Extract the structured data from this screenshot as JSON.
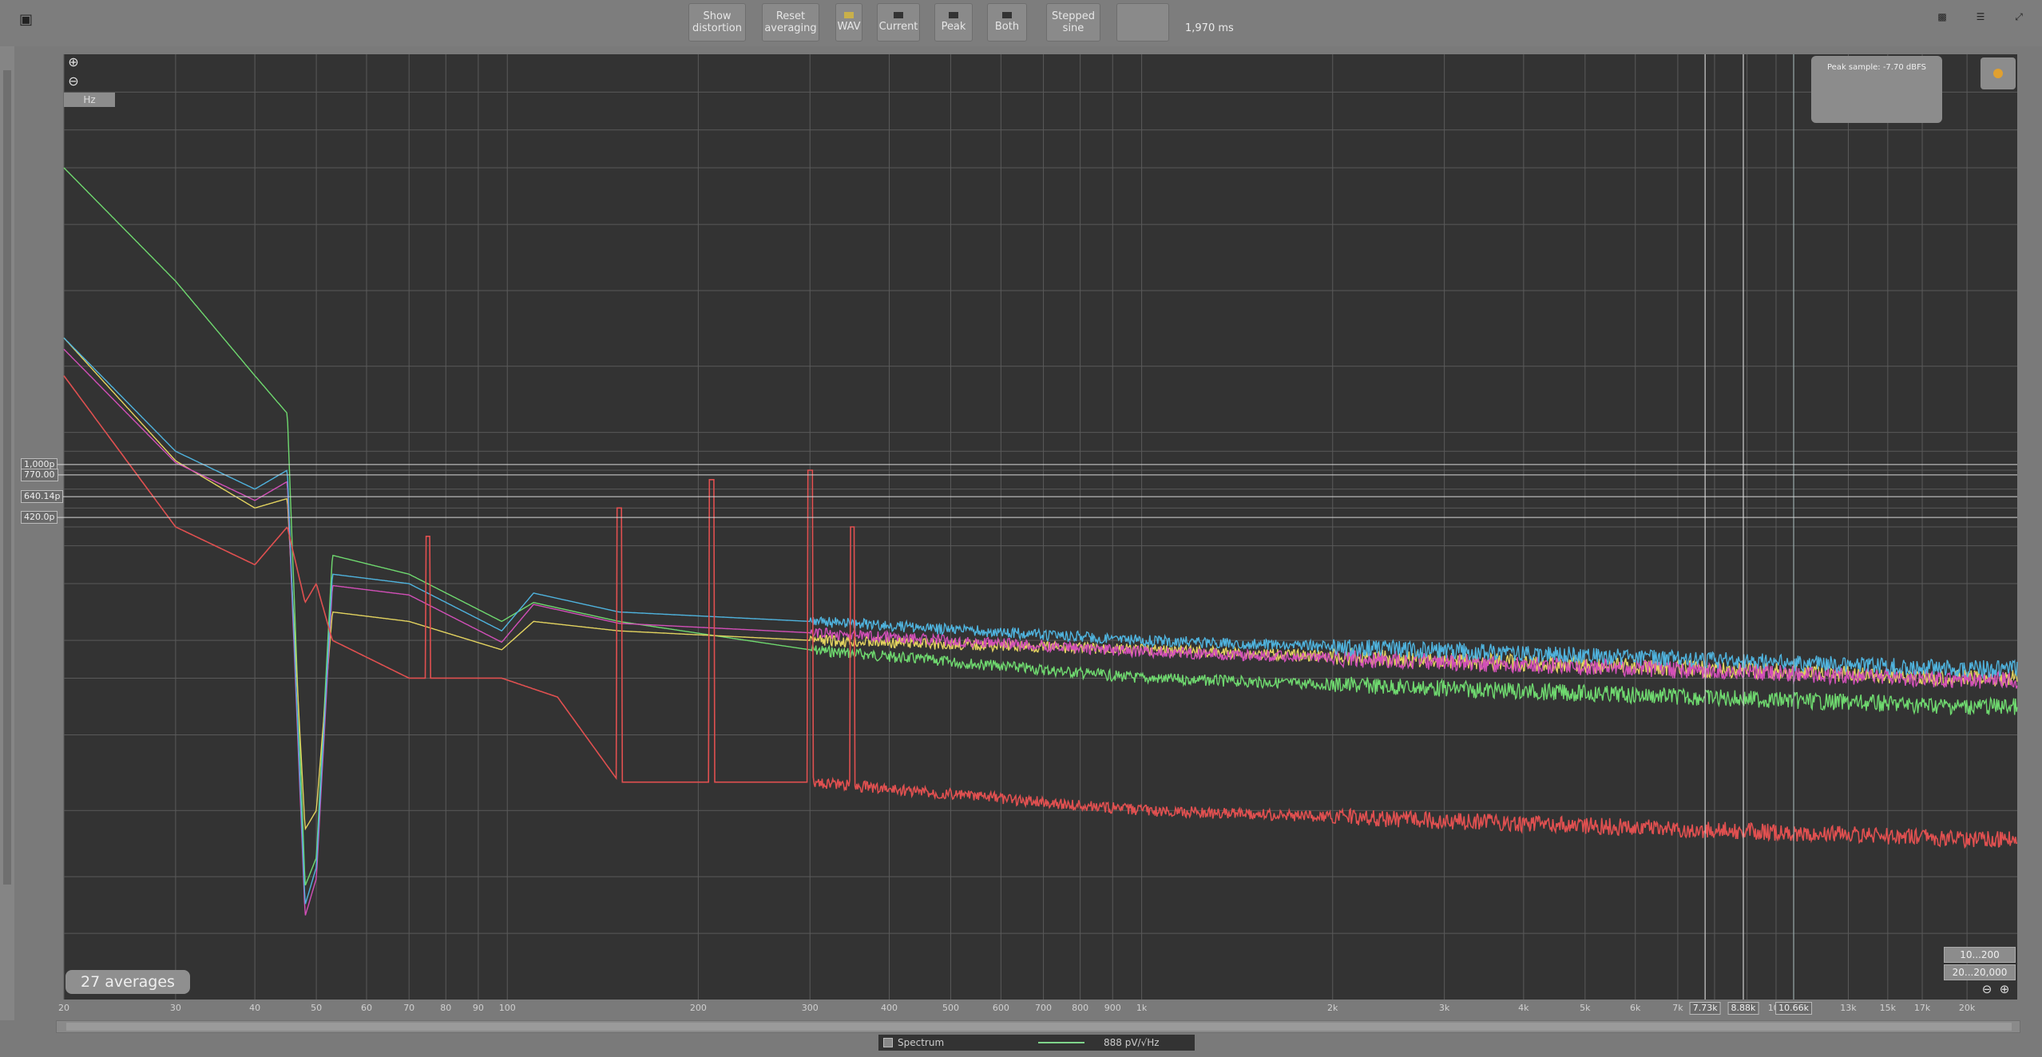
{
  "toolbar": {
    "buttons": [
      {
        "id": "show-distortion",
        "label": "Show\ndistortion"
      },
      {
        "id": "reset-averaging",
        "label": "Reset\naveraging"
      },
      {
        "id": "wav",
        "label": "WAV"
      },
      {
        "id": "current",
        "label": "Current"
      },
      {
        "id": "peak",
        "label": "Peak"
      },
      {
        "id": "both",
        "label": "Both"
      },
      {
        "id": "stepped-sine",
        "label": "Stepped\nsine"
      }
    ],
    "readout": "1,970 ms"
  },
  "plot": {
    "hz_label": "Hz",
    "averages_label": "27 averages",
    "range_top": "10...200",
    "range_bottom": "20...20,000",
    "info_box_lines": [
      "Peak sample: -7.70 dBFS"
    ]
  },
  "cursors": {
    "x_labels": [
      "7.73k",
      "8.88k",
      "10.66k"
    ],
    "y_labels": [
      "1,000p",
      "770.00",
      "640.14p",
      "420.0p"
    ]
  },
  "legend": {
    "name": "Spectrum",
    "value": "888 pV/√Hz",
    "color": "#7fd48a"
  },
  "chart_data": {
    "type": "line",
    "x_scale": "log",
    "xlim": [
      20,
      24000
    ],
    "xticks": [
      "20",
      "30",
      "40",
      "50",
      "60",
      "70",
      "80",
      "90",
      "100",
      "200",
      "300",
      "400",
      "500",
      "600",
      "700",
      "800",
      "900",
      "1k",
      "2k",
      "3k",
      "4k",
      "5k",
      "6k",
      "7k",
      "8k",
      "9k",
      "10k",
      "13k",
      "15k",
      "17k",
      "20k"
    ],
    "colors": {
      "blue": "#4fb3de",
      "magenta": "#d24fb8",
      "yellow": "#e3d35f",
      "green": "#6fd96f",
      "red": "#e05050"
    },
    "series": [
      {
        "id": "blue",
        "points": [
          [
            20,
            0.3
          ],
          [
            30,
            0.42
          ],
          [
            40,
            0.46
          ],
          [
            45,
            0.44
          ],
          [
            48,
            0.9
          ],
          [
            50,
            0.86
          ],
          [
            53,
            0.55
          ],
          [
            70,
            0.56
          ],
          [
            98,
            0.61
          ],
          [
            110,
            0.57
          ],
          [
            150,
            0.59
          ],
          [
            300,
            0.6
          ],
          [
            1000,
            0.62
          ],
          [
            20000,
            0.65
          ]
        ]
      },
      {
        "id": "yellow",
        "points": [
          [
            20,
            0.3
          ],
          [
            30,
            0.43
          ],
          [
            40,
            0.48
          ],
          [
            45,
            0.47
          ],
          [
            48,
            0.82
          ],
          [
            50,
            0.8
          ],
          [
            53,
            0.59
          ],
          [
            70,
            0.6
          ],
          [
            98,
            0.63
          ],
          [
            110,
            0.6
          ],
          [
            150,
            0.61
          ],
          [
            300,
            0.62
          ],
          [
            1000,
            0.63
          ],
          [
            20000,
            0.66
          ]
        ]
      },
      {
        "id": "green",
        "points": [
          [
            20,
            0.12
          ],
          [
            30,
            0.24
          ],
          [
            40,
            0.34
          ],
          [
            45,
            0.38
          ],
          [
            48,
            0.88
          ],
          [
            50,
            0.85
          ],
          [
            53,
            0.53
          ],
          [
            70,
            0.55
          ],
          [
            98,
            0.6
          ],
          [
            110,
            0.58
          ],
          [
            150,
            0.6
          ],
          [
            300,
            0.63
          ],
          [
            1000,
            0.66
          ],
          [
            20000,
            0.69
          ]
        ]
      },
      {
        "id": "red",
        "points": [
          [
            20,
            0.34
          ],
          [
            30,
            0.5
          ],
          [
            40,
            0.54
          ],
          [
            45,
            0.5
          ],
          [
            48,
            0.58
          ],
          [
            50,
            0.56
          ],
          [
            53,
            0.62
          ],
          [
            70,
            0.66
          ],
          [
            98,
            0.66
          ],
          [
            120,
            0.68
          ],
          [
            150,
            0.77
          ],
          [
            300,
            0.77
          ],
          [
            1000,
            0.8
          ],
          [
            20000,
            0.83
          ]
        ]
      }
    ]
  }
}
